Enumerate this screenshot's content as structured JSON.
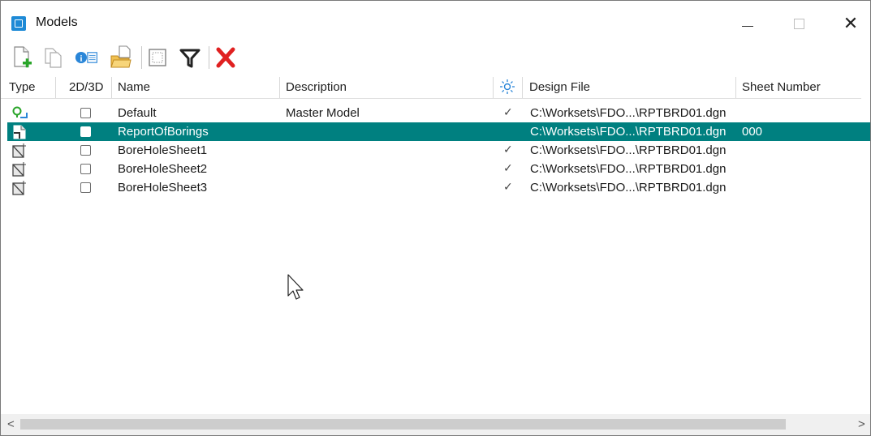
{
  "window": {
    "title": "Models"
  },
  "toolbar": {
    "buttons": [
      {
        "name": "create-model",
        "icon": "new-document-plus-icon"
      },
      {
        "name": "copy-model",
        "icon": "copy-document-icon"
      },
      {
        "name": "model-properties",
        "icon": "properties-info-icon"
      },
      {
        "name": "import-model",
        "icon": "import-folder-icon"
      },
      {
        "name": "select-all",
        "icon": "dotted-rectangle-icon"
      },
      {
        "name": "filter",
        "icon": "filter-funnel-icon"
      },
      {
        "name": "delete-model",
        "icon": "red-x-icon"
      }
    ]
  },
  "table": {
    "headers": {
      "type": "Type",
      "dim": "2D/3D",
      "name": "Name",
      "description": "Description",
      "active_icon": "sun-icon",
      "design_file": "Design File",
      "sheet_number": "Sheet Number"
    },
    "rows": [
      {
        "type_icon": "design-model-icon",
        "name": "Default",
        "description": "Master Model",
        "checked": true,
        "design_file": "C:\\Worksets\\FDO...\\RPTBRD01.dgn",
        "sheet_number": "",
        "selected": false
      },
      {
        "type_icon": "drawing-model-icon",
        "name": "ReportOfBorings",
        "description": "",
        "checked": false,
        "design_file": "C:\\Worksets\\FDO...\\RPTBRD01.dgn",
        "sheet_number": "000",
        "selected": true
      },
      {
        "type_icon": "sheet-model-icon",
        "name": "BoreHoleSheet1",
        "description": "",
        "checked": true,
        "design_file": "C:\\Worksets\\FDO...\\RPTBRD01.dgn",
        "sheet_number": "",
        "selected": false
      },
      {
        "type_icon": "sheet-model-icon",
        "name": "BoreHoleSheet2",
        "description": "",
        "checked": true,
        "design_file": "C:\\Worksets\\FDO...\\RPTBRD01.dgn",
        "sheet_number": "",
        "selected": false
      },
      {
        "type_icon": "sheet-model-icon",
        "name": "BoreHoleSheet3",
        "description": "",
        "checked": true,
        "design_file": "C:\\Worksets\\FDO...\\RPTBRD01.dgn",
        "sheet_number": "",
        "selected": false
      }
    ]
  },
  "scrollbar": {
    "left_arrow": "<",
    "right_arrow": ">"
  },
  "colors": {
    "selection": "#008080",
    "accent": "#1e8ad6",
    "delete": "#e02020"
  }
}
